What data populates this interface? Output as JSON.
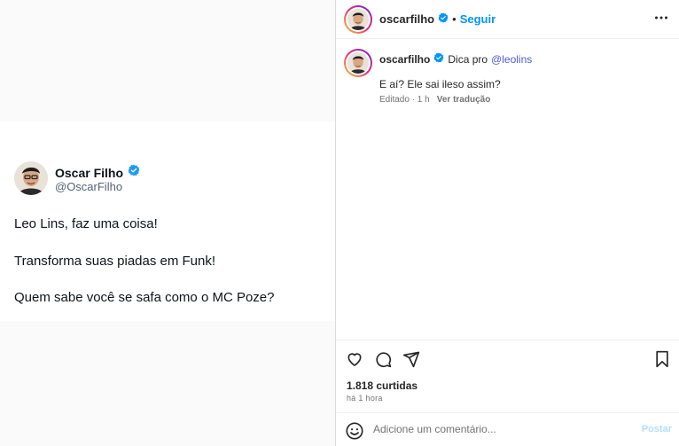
{
  "tweet": {
    "name": "Oscar Filho",
    "handle": "@OscarFilho",
    "lines": [
      "Leo Lins, faz uma coisa!",
      "Transforma suas piadas em Funk!",
      "Quem sabe você se safa como o MC Poze?"
    ]
  },
  "post_header": {
    "username": "oscarfilho",
    "separator": "•",
    "follow_label": "Seguir",
    "more_label": "•••"
  },
  "caption": {
    "username": "oscarfilho",
    "prefix": "Dica pro",
    "mention": "@leolins",
    "text": "E aí? Ele sai ileso assim?",
    "edited": "Editado · 1 h",
    "translate": "Ver tradução"
  },
  "engagement": {
    "likes": "1.818 curtidas",
    "time": "há 1 hora"
  },
  "comment": {
    "placeholder": "Adicione um comentário...",
    "post_label": "Postar"
  },
  "icons": {
    "like": "heart-icon",
    "comment": "comment-icon",
    "share": "share-icon",
    "save": "bookmark-icon",
    "emoji": "emoji-icon",
    "verified": "verified-badge-icon"
  },
  "colors": {
    "accent": "#0095f6",
    "mention": "#4f5bd5",
    "verified": "#1d9bf0"
  }
}
